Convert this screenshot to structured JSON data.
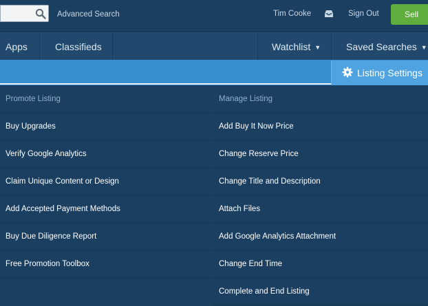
{
  "topbar": {
    "search_placeholder": "",
    "advanced_search": "Advanced Search",
    "user_name": "Tim Cooke",
    "sign_out": "Sign Out",
    "sell": "Sell"
  },
  "nav": {
    "apps": "Apps",
    "classifieds": "Classifieds",
    "watchlist": "Watchlist",
    "saved_searches": "Saved Searches",
    "caret": "▼"
  },
  "listing_settings": "Listing Settings",
  "promote": {
    "heading": "Promote Listing",
    "items": [
      "Buy Upgrades",
      "Verify Google Analytics",
      "Claim Unique Content or Design",
      "Add Accepted Payment Methods",
      "Buy Due Diligence Report",
      "Free Promotion Toolbox"
    ]
  },
  "manage": {
    "heading": "Manage Listing",
    "items": [
      "Add Buy It Now Price",
      "Change Reserve Price",
      "Change Title and Description",
      "Attach Files",
      "Add Google Analytics Attachment",
      "Change End Time",
      "Complete and End Listing"
    ]
  },
  "colors": {
    "background": "#1b3f60",
    "nav": "#20496d",
    "listing_bar": "#3a8fd1",
    "sell_button": "#5fad3d"
  }
}
